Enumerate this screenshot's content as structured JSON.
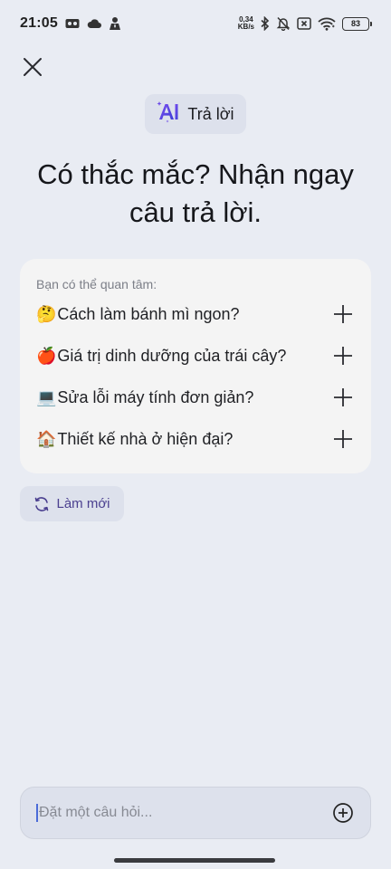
{
  "status_bar": {
    "time": "21:05",
    "net_speed_value": "0,34",
    "net_speed_unit": "KB/s",
    "battery": "83",
    "left_icons": [
      "screen-record-icon",
      "cloud-icon",
      "incognito-icon"
    ],
    "right_icons": [
      "bluetooth-icon",
      "bell-off-icon",
      "sim-x-icon",
      "wifi-icon",
      "battery-icon"
    ]
  },
  "header": {
    "close_icon": "close-icon",
    "badge_logo": "AI",
    "badge_label": "Trả lời"
  },
  "headline": {
    "line1": "Có thắc mắc? Nhận ngay",
    "line2": "câu trả lời."
  },
  "suggestions": {
    "caption": "Bạn có thể quan tâm:",
    "items": [
      {
        "emoji": "🤔",
        "label": "Cách làm bánh mì ngon?"
      },
      {
        "emoji": "🍎",
        "label": "Giá trị dinh dưỡng của trái cây?"
      },
      {
        "emoji": "💻",
        "label": "Sửa lỗi máy tính đơn giản?"
      },
      {
        "emoji": "🏠",
        "label": "Thiết kế nhà ở hiện đại?"
      }
    ]
  },
  "refresh": {
    "label": "Làm mới"
  },
  "ask": {
    "placeholder": "Đặt một câu hỏi...",
    "value": ""
  },
  "colors": {
    "background": "#e9ecf3",
    "accent": "#5b3fd9",
    "card": "#f4f4f4",
    "chip": "#dde1ec"
  }
}
